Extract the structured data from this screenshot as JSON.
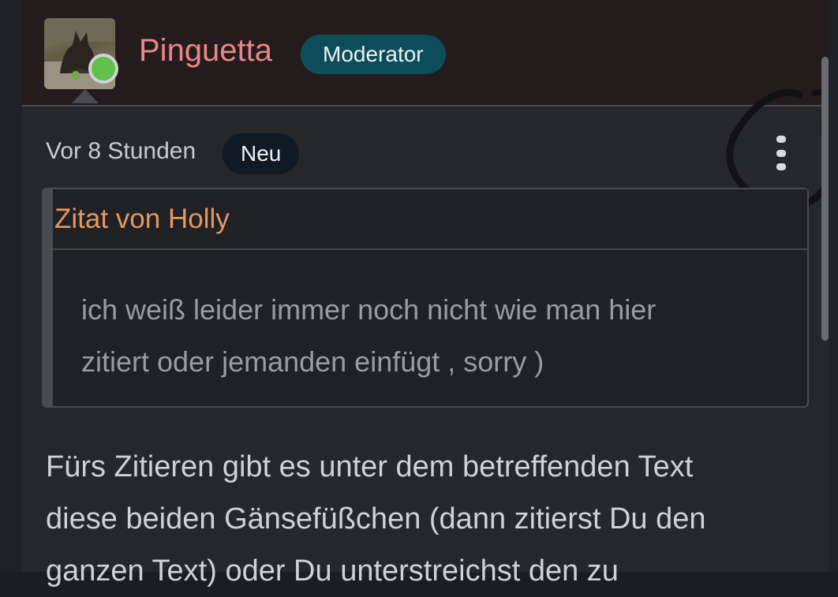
{
  "post": {
    "author": "Pinguetta",
    "role_badge": "Moderator",
    "time": "Vor 8 Stunden",
    "new_badge": "Neu",
    "quote": {
      "author_line": "Zitat von Holly",
      "lines": [
        "ich weiß leider immer noch nicht wie man hier",
        "zitiert oder jemanden einfügt , sorry )"
      ]
    },
    "body_lines": [
      "Fürs Zitieren gibt es unter dem betreffenden Text",
      "diese beiden Gänsefüßchen (dann zitierst Du den",
      "ganzen Text) oder Du unterstreichst den zu"
    ]
  },
  "colors": {
    "username": "#e9868a",
    "role_badge_bg": "#0d4d5a",
    "online_status": "#5fc04b",
    "quote_author": "#e7975f"
  },
  "icons": {
    "more": "vertical-ellipsis-icon",
    "status": "online-status-icon",
    "annotation": "hand-drawn-circle"
  }
}
